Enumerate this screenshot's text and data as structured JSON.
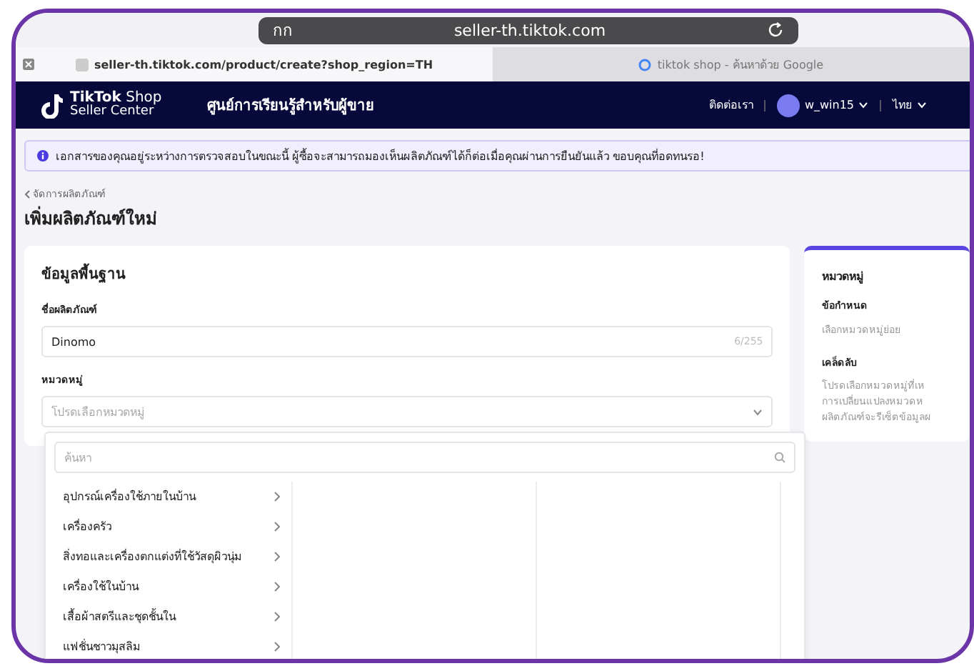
{
  "browser": {
    "address_label": "กก",
    "domain": "seller-th.tiktok.com",
    "tabs": [
      {
        "title": "seller-th.tiktok.com/product/create?shop_region=TH",
        "selected": true
      },
      {
        "title": "tiktok shop - ค้นหาด้วย Google",
        "selected": false
      }
    ]
  },
  "header": {
    "logo_brand": "TikTok",
    "logo_shop": "Shop",
    "logo_sub": "Seller Center",
    "learning_center": "ศูนย์การเรียนรู้สำหรับผู้ขาย",
    "contact": "ติดต่อเรา",
    "user": "w_win15",
    "language": "ไทย"
  },
  "notice": "เอกสารของคุณอยู่ระหว่างการตรวจสอบในขณะนี้ ผู้ซื้อจะสามารถมองเห็นผลิตภัณฑ์ได้ก็ต่อเมื่อคุณผ่านการยืนยันแล้ว ขอบคุณที่อดทนรอ!",
  "breadcrumb": "จัดการผลิตภัณฑ์",
  "page_title": "เพิ่มผลิตภัณฑ์ใหม่",
  "basic_info": {
    "title": "ข้อมูลพื้นฐาน",
    "name_label": "ชื่อผลิตภัณฑ์",
    "name_value": "Dinomo",
    "name_count": "6/255",
    "category_label": "หมวดหมู่",
    "category_placeholder": "โปรดเลือกหมวดหมู่",
    "search_placeholder": "ค้นหา",
    "categories": [
      "อุปกรณ์เครื่องใช้ภายในบ้าน",
      "เครื่องครัว",
      "สิ่งทอและเครื่องตกแต่งที่ใช้วัสดุผิวนุ่ม",
      "เครื่องใช้ในบ้าน",
      "เสื้อผ้าสตรีและชุดชั้นใน",
      "แฟชั่นชาวมุสลิม"
    ]
  },
  "side": {
    "title": "หมวดหมู่",
    "requirement_label": "ข้อกำหนด",
    "requirement_text": "เลือกหมวดหมู่ย่อย",
    "tips_label": "เคล็ดลับ",
    "tips_lines": [
      "โปรดเลือกหมวดหมู่ที่เห",
      "การเปลี่ยนแปลงหมวดห",
      "ผลิตภัณฑ์จะรีเซ็ตข้อมูลผ"
    ]
  }
}
